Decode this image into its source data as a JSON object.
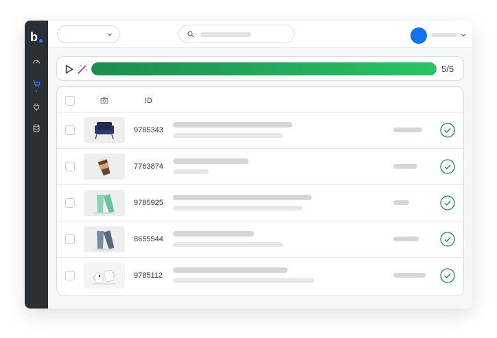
{
  "sidebar": {
    "logo": "b",
    "items": [
      {
        "icon": "speedometer-icon"
      },
      {
        "icon": "cart-icon",
        "active": true
      },
      {
        "icon": "plug-icon"
      },
      {
        "icon": "database-icon"
      }
    ]
  },
  "header": {
    "dropdown_value": "",
    "search_placeholder": "",
    "user_name": ""
  },
  "progress": {
    "completed": 5,
    "total": 5,
    "fraction": 1.0,
    "label": "5/5",
    "colors": {
      "start": "#1c8d50",
      "end": "#27c464"
    }
  },
  "table": {
    "columns": [
      "",
      "camera-icon",
      "ID"
    ],
    "rows": [
      {
        "id": "9785343",
        "image": "armchair",
        "status": "complete"
      },
      {
        "id": "7763874",
        "image": "coffee-cup",
        "status": "complete"
      },
      {
        "id": "9785925",
        "image": "green-tumblers",
        "status": "complete"
      },
      {
        "id": "8655544",
        "image": "gray-tumblers",
        "status": "complete"
      },
      {
        "id": "9785112",
        "image": "white-mugs",
        "status": "complete"
      }
    ]
  },
  "colors": {
    "accent": "#1473f4",
    "success": "#1f8a4c",
    "sidebar": "#2b3035"
  }
}
